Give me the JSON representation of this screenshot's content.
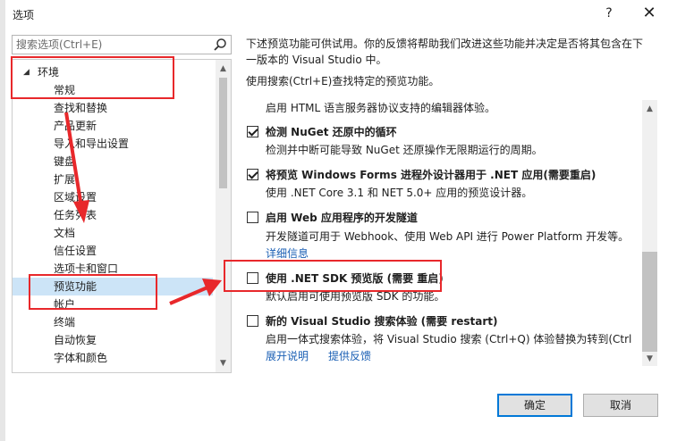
{
  "window": {
    "title": "选项",
    "help_label": "?",
    "close_label": "✕"
  },
  "search": {
    "placeholder": "搜索选项(Ctrl+E)"
  },
  "tree": {
    "section": "环境",
    "items": [
      "常规",
      "查找和替换",
      "产品更新",
      "导入和导出设置",
      "键盘",
      "扩展",
      "区域设置",
      "任务列表",
      "文档",
      "信任设置",
      "选项卡和窗口",
      "预览功能",
      "帐户",
      "终端",
      "自动恢复",
      "字体和颜色"
    ],
    "selected": "预览功能"
  },
  "intro": {
    "line1": "下述预览功能可供试用。你的反馈将帮助我们改进这些功能并决定是否将其包含在下",
    "line2": "一版本的 Visual Studio 中。",
    "hint": "使用搜索(Ctrl+E)查找特定的预览功能。"
  },
  "options": {
    "partial_desc": "启用 HTML 语言服务器协议支持的编辑器体验。",
    "nuget": {
      "checked": true,
      "title": "检测 NuGet 还原中的循环",
      "desc": "检测并中断可能导致 NuGet 还原操作无限期运行的周期。"
    },
    "winforms": {
      "checked": true,
      "title": "将预览 Windows Forms 进程外设计器用于 .NET 应用(需要重启)",
      "desc": "使用 .NET Core 3.1 和 NET 5.0+ 应用的预览设计器。"
    },
    "web_tunnel": {
      "checked": false,
      "title": "启用 Web 应用程序的开发隧道",
      "desc": "开发隧道可用于 Webhook、使用 Web API 进行 Power Platform 开发等。",
      "link": "详细信息"
    },
    "dotnet_sdk": {
      "checked": false,
      "title": "使用 .NET SDK 预览版 (需要 重启)",
      "desc": "默认启用可使用预览版 SDK 的功能。"
    },
    "search_exp": {
      "checked": false,
      "title": "新的 Visual Studio 搜索体验 (需要 restart)",
      "desc": "启用一体式搜索体验，将 Visual Studio 搜索 (Ctrl+Q) 体验替换为转到(Ctrl",
      "link1": "展开说明",
      "link2": "提供反馈"
    }
  },
  "buttons": {
    "ok": "确定",
    "cancel": "取消"
  },
  "colors": {
    "annotation": "#e8282b",
    "selection": "#cce4f7",
    "link": "#1a5fb4"
  }
}
